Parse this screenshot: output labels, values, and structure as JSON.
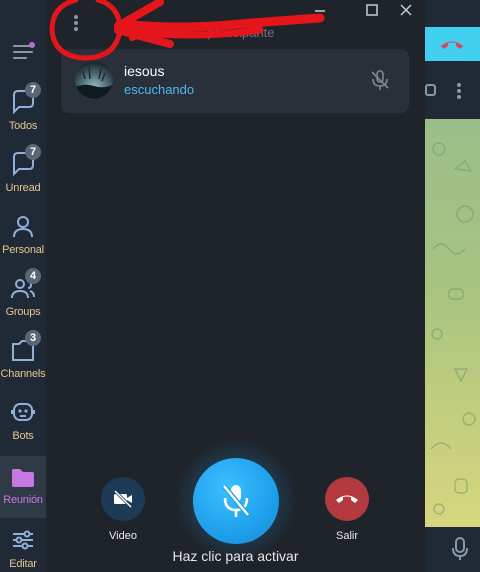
{
  "sidebar": {
    "menu_icon": "hamburger-menu-icon",
    "folders": [
      {
        "label": "Todos",
        "badge": "7",
        "icon": "chat-bubble-icon"
      },
      {
        "label": "Unread",
        "badge": "7",
        "icon": "chat-bubble-icon"
      },
      {
        "label": "Personal",
        "badge": "",
        "icon": "person-icon"
      },
      {
        "label": "Groups",
        "badge": "4",
        "icon": "group-icon"
      },
      {
        "label": "Channels",
        "badge": "3",
        "icon": "channel-icon"
      },
      {
        "label": "Bots",
        "badge": "",
        "icon": "bot-icon"
      },
      {
        "label": "Reunión",
        "badge": "",
        "icon": "folder-icon"
      },
      {
        "label": "Editar",
        "badge": "",
        "icon": "sliders-icon"
      }
    ]
  },
  "voice_chat": {
    "participant_count": "1 participante",
    "window_controls": [
      "minimize-icon",
      "maximize-icon",
      "close-icon"
    ],
    "participant": {
      "name": "iesous",
      "status": "escuchando",
      "icon": "microphone-muted-icon"
    },
    "video_label": "Video",
    "leave_label": "Salir",
    "hint": "Haz clic para activar"
  },
  "colors": {
    "accent_blue": "#1ea0ec",
    "status_blue": "#4db8f0",
    "leave_red": "#b23a3f",
    "folder_label": "#e3c78c",
    "folder_active": "#c878e0",
    "annotation_red": "#e4161c"
  }
}
